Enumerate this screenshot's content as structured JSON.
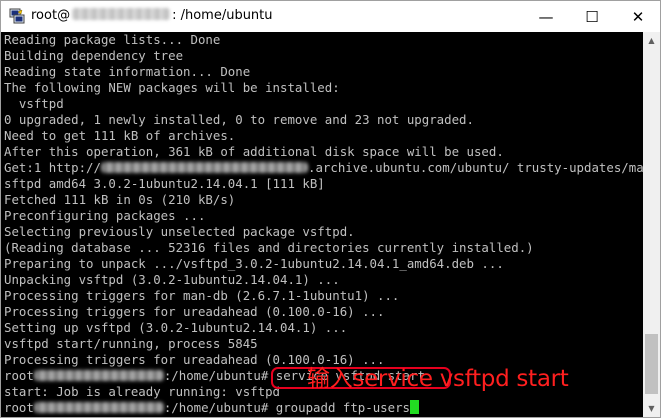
{
  "window": {
    "title_user": "root@",
    "title_path": ": /home/ubuntu",
    "controls": {
      "minimize": "—",
      "maximize": "☐",
      "close": "✕"
    }
  },
  "terminal": {
    "lines": [
      {
        "text": "Reading package lists... Done"
      },
      {
        "text": "Building dependency tree"
      },
      {
        "text": "Reading state information... Done"
      },
      {
        "text": "The following NEW packages will be installed:"
      },
      {
        "text": "  vsftpd"
      },
      {
        "text": "0 upgraded, 1 newly installed, 0 to remove and 23 not upgraded."
      },
      {
        "text": "Need to get 111 kB of archives."
      },
      {
        "text": "After this operation, 361 kB of additional disk space will be used."
      },
      {
        "pre": "Get:1 http://",
        "post": ".archive.ubuntu.com/ubuntu/ trusty-updates/main v"
      },
      {
        "text": "sftpd amd64 3.0.2-1ubuntu2.14.04.1 [111 kB]"
      },
      {
        "text": "Fetched 111 kB in 0s (210 kB/s)"
      },
      {
        "text": "Preconfiguring packages ..."
      },
      {
        "text": "Selecting previously unselected package vsftpd."
      },
      {
        "text": "(Reading database ... 52316 files and directories currently installed.)"
      },
      {
        "text": "Preparing to unpack .../vsftpd_3.0.2-1ubuntu2.14.04.1_amd64.deb ..."
      },
      {
        "text": "Unpacking vsftpd (3.0.2-1ubuntu2.14.04.1) ..."
      },
      {
        "text": "Processing triggers for man-db (2.6.7.1-1ubuntu1) ..."
      },
      {
        "text": "Processing triggers for ureadahead (0.100.0-16) ..."
      },
      {
        "text": "Setting up vsftpd (3.0.2-1ubuntu2.14.04.1) ..."
      },
      {
        "text": "vsftpd start/running, process 5845"
      },
      {
        "text": "Processing triggers for ureadahead (0.100.0-16) ..."
      },
      {
        "pre": "root",
        "post": ":/home/ubuntu# service vsftpd start"
      },
      {
        "text": "start: Job is already running: vsftpd"
      },
      {
        "pre": "root",
        "post": ":/home/ubuntu# groupadd ftp-users"
      }
    ]
  },
  "annotation": {
    "text": "输入service vsftpd start"
  },
  "colors": {
    "terminal_bg": "#000000",
    "terminal_fg": "#c0c0c0",
    "cursor": "#22dd22",
    "annotation": "#ff1f1f"
  },
  "icons": {
    "app": "putty-icon"
  }
}
